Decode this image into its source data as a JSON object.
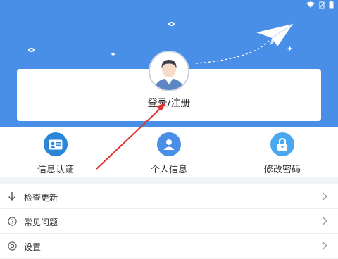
{
  "profile": {
    "login_label": "登录/注册"
  },
  "shortcuts": [
    {
      "label": "信息认证",
      "icon": "id-card-icon",
      "color": "#2a86d8"
    },
    {
      "label": "个人信息",
      "icon": "person-icon",
      "color": "#4a8fe7"
    },
    {
      "label": "修改密码",
      "icon": "lock-icon",
      "color": "#4aa8f0"
    }
  ],
  "menu": [
    {
      "label": "检查更新",
      "icon": "download-arrow-icon"
    },
    {
      "label": "常见问题",
      "icon": "question-circle-icon"
    },
    {
      "label": "设置",
      "icon": "settings-icon"
    }
  ],
  "theme": {
    "header_color": "#4a8fe7",
    "annotation_arrow_color": "#e0322f"
  }
}
